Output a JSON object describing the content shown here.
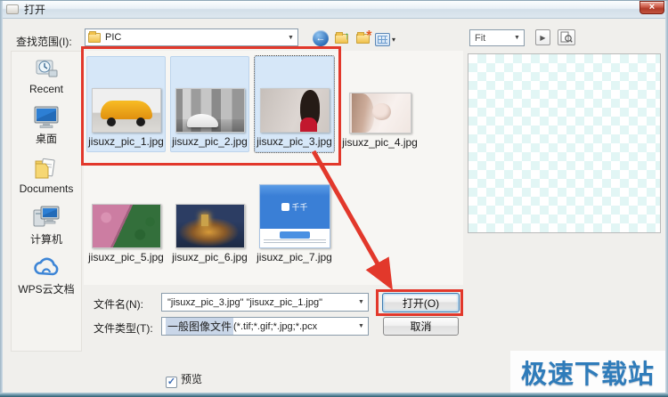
{
  "window": {
    "title": "打开"
  },
  "toolbar": {
    "look_in_label": "查找范围(I):",
    "look_in_value": "PIC",
    "fit_value": "Fit"
  },
  "sidebar": {
    "items": [
      {
        "label": "Recent"
      },
      {
        "label": "桌面"
      },
      {
        "label": "Documents"
      },
      {
        "label": "计算机"
      },
      {
        "label": "WPS云文档"
      }
    ]
  },
  "files": [
    {
      "name": "jisuxz_pic_1.jpg",
      "selected": true,
      "thumb": "yellow-suv-photo"
    },
    {
      "name": "jisuxz_pic_2.jpg",
      "selected": true,
      "thumb": "white-sports-car-showroom-photo"
    },
    {
      "name": "jisuxz_pic_3.jpg",
      "selected": true,
      "focused": true,
      "thumb": "woman-in-red-dress-photo"
    },
    {
      "name": "jisuxz_pic_4.jpg",
      "selected": false,
      "thumb": "pale-portrait-photo"
    },
    {
      "name": "jisuxz_pic_5.jpg",
      "selected": false,
      "thumb": "pink-green-forest-aerial-photo"
    },
    {
      "name": "jisuxz_pic_6.jpg",
      "selected": false,
      "thumb": "night-hilltop-town-photo"
    },
    {
      "name": "jisuxz_pic_7.jpg",
      "selected": false,
      "thumb": "blue-installer-screenshot",
      "thumb_text": "千千"
    }
  ],
  "form": {
    "filename_label": "文件名(N):",
    "filename_value": "\"jisuxz_pic_3.jpg\" \"jisuxz_pic_1.jpg\"",
    "filetype_label": "文件类型(T):",
    "filetype_value_highlight": "一般图像文件",
    "filetype_value_rest": " (*.tif;*.gif;*.jpg;*.pcx",
    "open_button": "打开(O)",
    "cancel_button": "取消",
    "preview_checkbox": "预览",
    "preview_checked": true
  },
  "watermark": "极速下载站",
  "icons": {
    "close_glyph": "×",
    "back_glyph": "←",
    "up_glyph": "↑",
    "new_folder_glyph": "*",
    "views_arrow_glyph": "▾",
    "combo_arrow_glyph": "▼",
    "play_glyph": "▶",
    "check_glyph": "✓"
  },
  "colors": {
    "annotation_red": "#e2382b",
    "selection_blue": "#d6e7f8",
    "watermark_blue": "#2f7cba",
    "titlebar_close_red": "#b03a28"
  }
}
